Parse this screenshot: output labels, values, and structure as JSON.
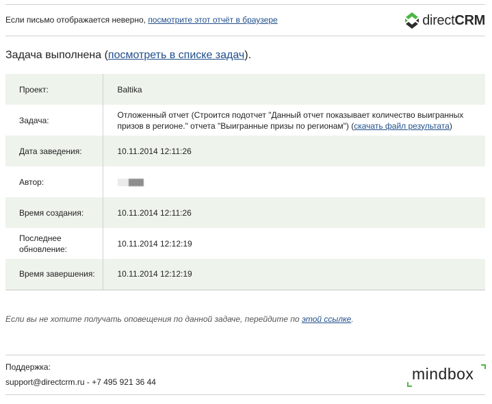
{
  "header": {
    "browser_note_prefix": "Если письмо отображается неверно, ",
    "browser_link": "посмотрите этот отчёт в браузере",
    "logo": {
      "part1": "direct",
      "part2": "CRM",
      "icon": "directcrm-logo-icon",
      "accent": "#4db548"
    }
  },
  "task": {
    "heading_prefix": "Задача выполнена (",
    "heading_link": "посмотреть в списке задач",
    "heading_suffix": ")."
  },
  "details": {
    "project": {
      "label": "Проект:",
      "value": "Baltika"
    },
    "task": {
      "label": "Задача:",
      "value_text": "Отложенный отчет (Строится подотчет \"Данный отчет показывает количество выигранных призов в регионе.\" отчета \"Выигранные призы по регионам\") (",
      "download_link": "скачать файл результата",
      "value_suffix": ")"
    },
    "created_date": {
      "label": "Дата заведения:",
      "value": "10.11.2014 12:11:26"
    },
    "author": {
      "label": "Автор:"
    },
    "creation_time": {
      "label": "Время создания:",
      "value": "10.11.2014 12:11:26"
    },
    "last_update": {
      "label": "Последнее обновление:",
      "value": "10.11.2014 12:12:19"
    },
    "completion_time": {
      "label": "Время завершения:",
      "value": "10.11.2014 12:12:19"
    }
  },
  "footer": {
    "unsubscribe_prefix": "Если вы не хотите получать оповещения по данной задаче, перейдите по ",
    "unsubscribe_link": "этой ссылке",
    "unsubscribe_suffix": ".",
    "support_label": "Поддержка:",
    "support_email": "support@directcrm.ru",
    "support_separator": " - ",
    "support_phone": "+7 495 921 36 44",
    "mindbox_logo": "mindbox"
  },
  "colors": {
    "row_shade": "#eef4ec",
    "link": "#1f4d8a",
    "brand_green": "#4db548"
  }
}
